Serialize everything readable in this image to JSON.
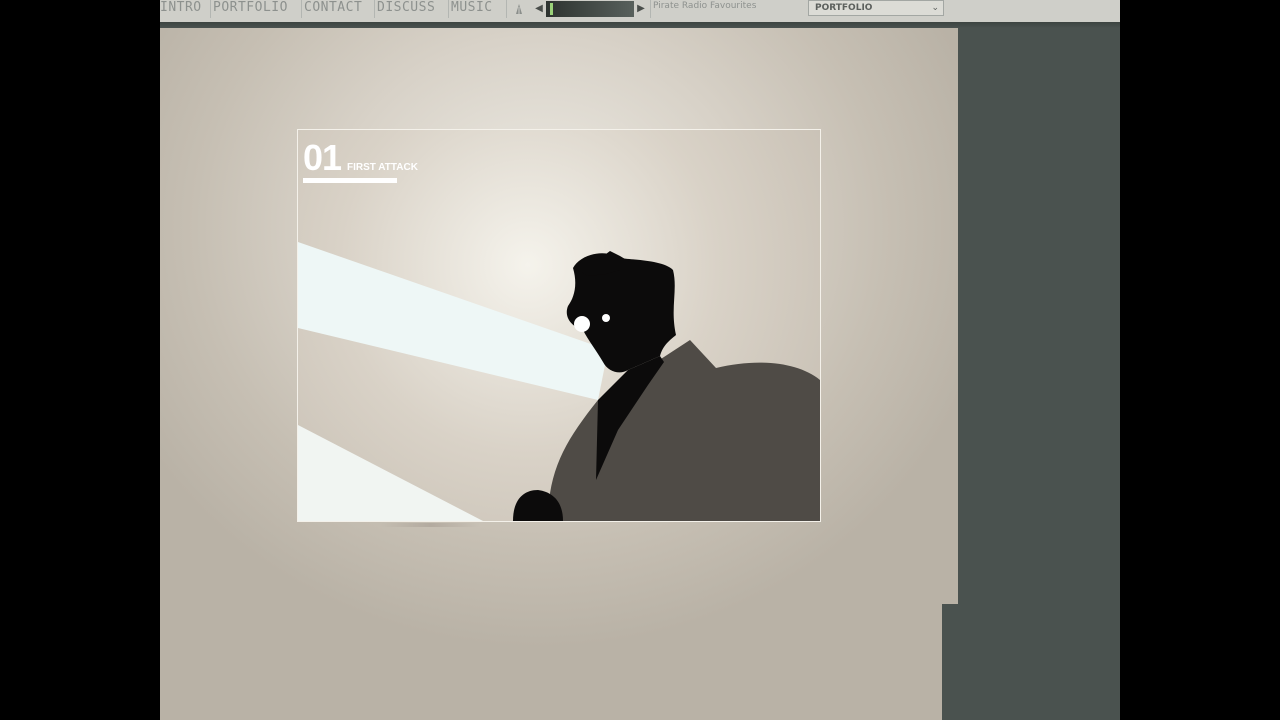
{
  "nav": {
    "items": [
      {
        "label": "INTRO"
      },
      {
        "label": "PORTFOLIO"
      },
      {
        "label": "CONTACT"
      },
      {
        "label": "DISCUSS"
      },
      {
        "label": "MUSIC"
      }
    ]
  },
  "player": {
    "volume_icon": "volume-icon",
    "prev_icon": "◀",
    "next_icon": "▶",
    "track_title": "Pirate Radio Favourites",
    "progress": 0.02
  },
  "section_select": {
    "selected": "PORTFOLIO",
    "chevron": "⌄"
  },
  "artwork": {
    "number": "01",
    "title": "FIRST ATTACK"
  },
  "colors": {
    "nav_bg": "#cfcfc9",
    "nav_text": "#8d918e",
    "outer_bg": "#4a524f",
    "panel_light": "#efede6",
    "panel_dark": "#b9b2a6",
    "figure": "#0c0b0b",
    "cloak": "#4f4b46",
    "light_beam": "#eef7f6"
  }
}
